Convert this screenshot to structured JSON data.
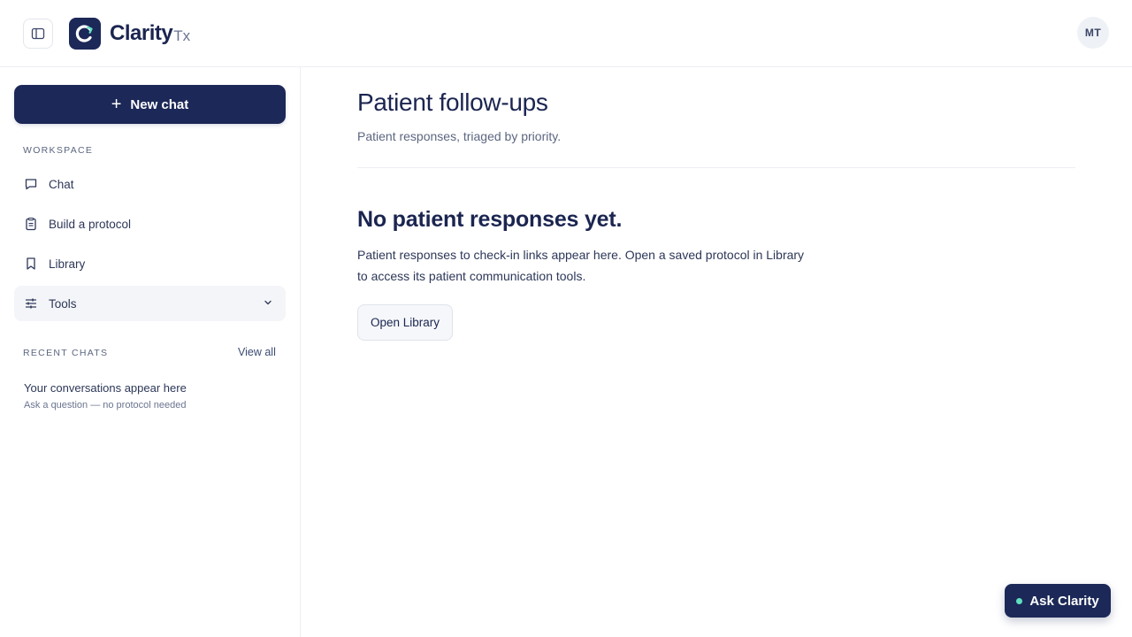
{
  "header": {
    "brand_name": "Clarity",
    "brand_suffix": "Tx",
    "avatar_initials": "MT"
  },
  "sidebar": {
    "new_chat_label": "New chat",
    "workspace_label": "WORKSPACE",
    "items": [
      {
        "label": "Chat",
        "icon": "chat-bubble-icon"
      },
      {
        "label": "Build a protocol",
        "icon": "clipboard-icon"
      },
      {
        "label": "Library",
        "icon": "bookmark-icon"
      },
      {
        "label": "Tools",
        "icon": "sliders-icon",
        "active": true
      }
    ],
    "recent_label": "RECENT CHATS",
    "view_all_label": "View all",
    "recent_empty_title": "Your conversations appear here",
    "recent_empty_subtitle": "Ask a question — no protocol needed"
  },
  "main": {
    "title": "Patient follow-ups",
    "subtitle": "Patient responses, triaged by priority.",
    "empty_title": "No patient responses yet.",
    "empty_body": "Patient responses to check-in links appear here. Open a saved protocol in Library to access its patient communication tools.",
    "open_library_label": "Open Library"
  },
  "assistant": {
    "label": "Ask Clarity"
  },
  "colors": {
    "brand_navy": "#1c2857",
    "status_dot": "#5fe0c1"
  }
}
